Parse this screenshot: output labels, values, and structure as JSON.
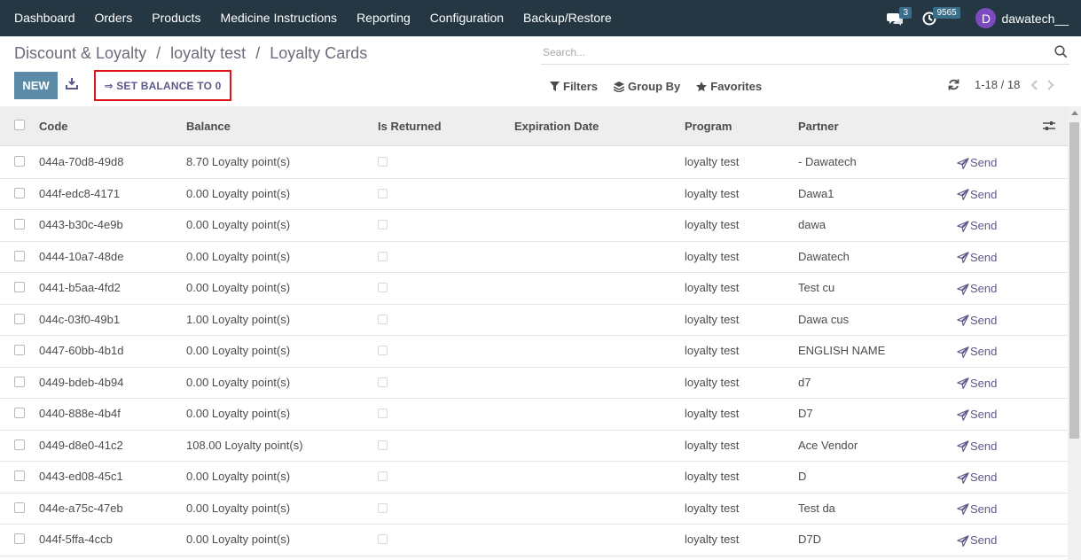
{
  "navbar": {
    "items": [
      "Dashboard",
      "Orders",
      "Products",
      "Medicine Instructions",
      "Reporting",
      "Configuration",
      "Backup/Restore"
    ],
    "messages_count": "3",
    "activities_count": "9565",
    "user_initial": "D",
    "user_name": "dawatech__"
  },
  "breadcrumb": {
    "items": [
      "Discount & Loyalty",
      "loyalty test",
      "Loyalty Cards"
    ],
    "separator": "/"
  },
  "search": {
    "placeholder": "Search..."
  },
  "toolbar": {
    "new_label": "NEW",
    "set_balance_label": "⇒ SET BALANCE TO 0"
  },
  "filters": {
    "filters_label": "Filters",
    "group_by_label": "Group By",
    "favorites_label": "Favorites"
  },
  "pager": {
    "value": "1-18 / 18"
  },
  "table": {
    "columns": [
      "Code",
      "Balance",
      "Is Returned",
      "Expiration Date",
      "Program",
      "Partner"
    ],
    "send_label": "Send",
    "rows": [
      {
        "code": "044a-70d8-49d8",
        "balance": "8.70 Loyalty point(s)",
        "program": "loyalty test",
        "partner": "- Dawatech"
      },
      {
        "code": "044f-edc8-4171",
        "balance": "0.00 Loyalty point(s)",
        "program": "loyalty test",
        "partner": "Dawa1"
      },
      {
        "code": "0443-b30c-4e9b",
        "balance": "0.00 Loyalty point(s)",
        "program": "loyalty test",
        "partner": "dawa"
      },
      {
        "code": "0444-10a7-48de",
        "balance": "0.00 Loyalty point(s)",
        "program": "loyalty test",
        "partner": "Dawatech"
      },
      {
        "code": "0441-b5aa-4fd2",
        "balance": "0.00 Loyalty point(s)",
        "program": "loyalty test",
        "partner": "Test cu"
      },
      {
        "code": "044c-03f0-49b1",
        "balance": "1.00 Loyalty point(s)",
        "program": "loyalty test",
        "partner": "Dawa cus"
      },
      {
        "code": "0447-60bb-4b1d",
        "balance": "0.00 Loyalty point(s)",
        "program": "loyalty test",
        "partner": "ENGLISH NAME"
      },
      {
        "code": "0449-bdeb-4b94",
        "balance": "0.00 Loyalty point(s)",
        "program": "loyalty test",
        "partner": "d7"
      },
      {
        "code": "0440-888e-4b4f",
        "balance": "0.00 Loyalty point(s)",
        "program": "loyalty test",
        "partner": "D7"
      },
      {
        "code": "0449-d8e0-41c2",
        "balance": "108.00 Loyalty point(s)",
        "program": "loyalty test",
        "partner": "Ace Vendor"
      },
      {
        "code": "0443-ed08-45c1",
        "balance": "0.00 Loyalty point(s)",
        "program": "loyalty test",
        "partner": "D"
      },
      {
        "code": "044e-a75c-47eb",
        "balance": "0.00 Loyalty point(s)",
        "program": "loyalty test",
        "partner": "Test da"
      },
      {
        "code": "044f-5ffa-4ccb",
        "balance": "0.00 Loyalty point(s)",
        "program": "loyalty test",
        "partner": "D7D"
      }
    ]
  },
  "colors": {
    "navbar_bg": "#243742",
    "primary_button": "#5c8ba8",
    "highlight_border": "#e0121a",
    "link": "#5c5a8a"
  }
}
